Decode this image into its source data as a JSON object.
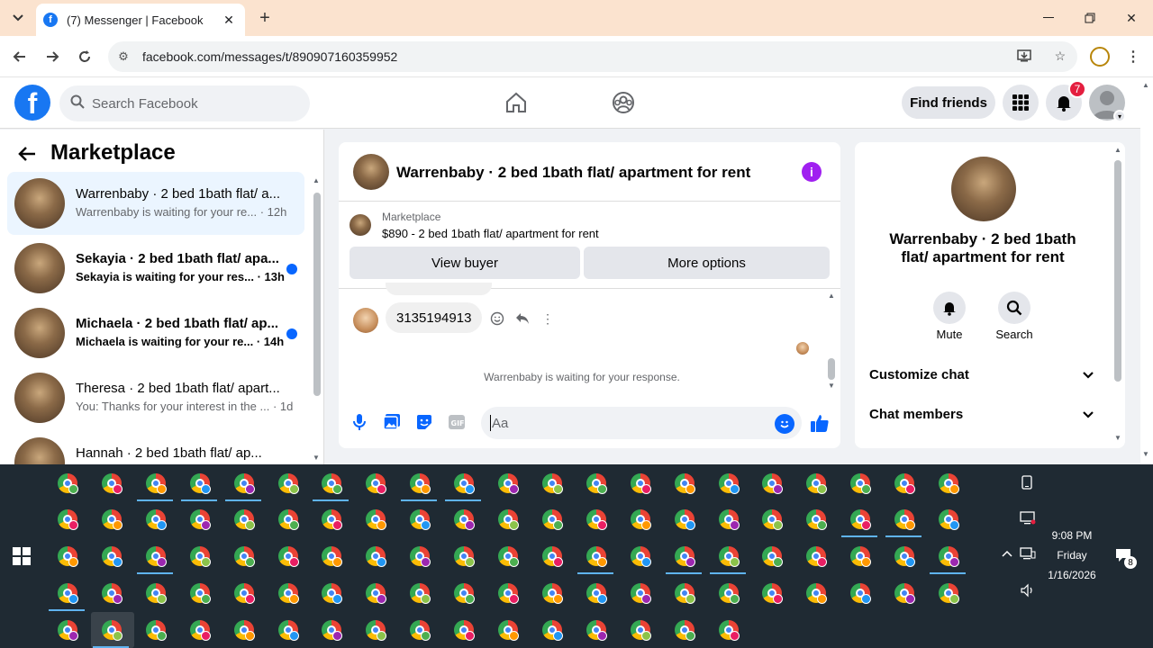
{
  "browser": {
    "tab_title": "(7) Messenger | Facebook",
    "url": "facebook.com/messages/t/890907160359952"
  },
  "fb": {
    "search_placeholder": "Search Facebook",
    "find_friends_label": "Find friends",
    "notification_count": "7",
    "brand_color": "#1877f2"
  },
  "sidebar": {
    "title": "Marketplace",
    "conversations": [
      {
        "name": "Warrenbaby · 2 bed 1bath flat/ a...",
        "snippet": "Warrenbaby is waiting for your re... · 12h",
        "active": true,
        "unread": false
      },
      {
        "name": "Sekayia · 2 bed 1bath flat/ apa...",
        "snippet": "Sekayia is waiting for your res... · 13h",
        "active": false,
        "unread": true
      },
      {
        "name": "Michaela · 2 bed 1bath flat/ ap...",
        "snippet": "Michaela is waiting for your re... · 14h",
        "active": false,
        "unread": true
      },
      {
        "name": "Theresa · 2 bed 1bath flat/ apart...",
        "snippet": "You: Thanks for your interest in the ... · 1d",
        "active": false,
        "unread": false
      },
      {
        "name": "Hannah · 2 bed 1bath flat/ ap...",
        "snippet": "",
        "active": false,
        "unread": false
      }
    ]
  },
  "chat": {
    "title": "Warrenbaby · 2 bed 1bath flat/ apartment for rent",
    "marketplace_label": "Marketplace",
    "listing": "$890 - 2 bed 1bath flat/ apartment for rent",
    "view_buyer_label": "View buyer",
    "more_options_label": "More options",
    "message": "3135194913",
    "waiting_text": "Warrenbaby is waiting for your response.",
    "composer_placeholder": "Aa"
  },
  "details": {
    "title": "Warrenbaby · 2 bed 1bath flat/ apartment for rent",
    "mute_label": "Mute",
    "search_label": "Search",
    "customize_label": "Customize chat",
    "members_label": "Chat members"
  },
  "taskbar": {
    "time": "9:08 PM",
    "day": "Friday",
    "date": "1/16/2026",
    "notification_count": "8"
  }
}
